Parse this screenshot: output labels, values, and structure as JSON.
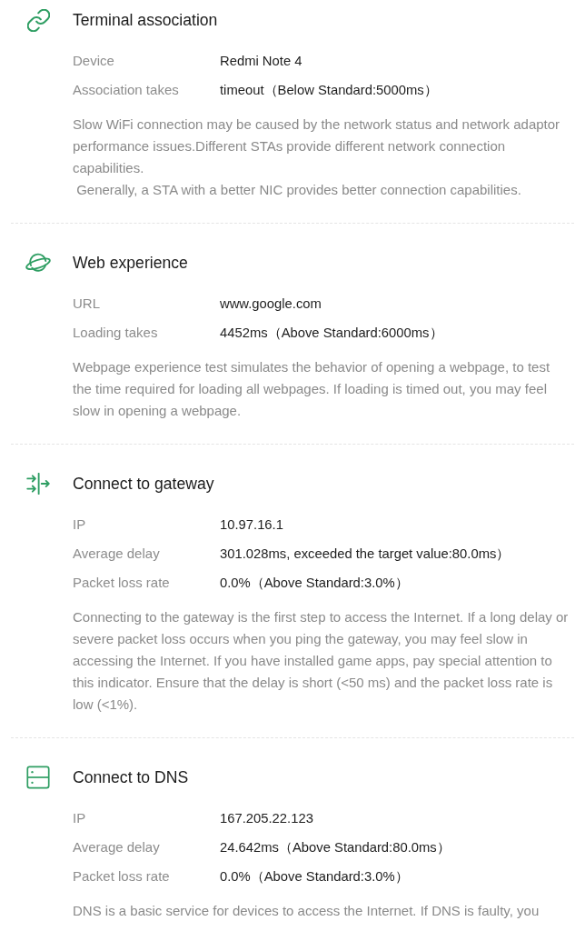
{
  "sections": [
    {
      "kind": "link",
      "title": "Terminal association",
      "rows": [
        {
          "label": "Device",
          "value": "Redmi Note 4"
        },
        {
          "label": "Association takes",
          "value": "timeout（Below Standard:5000ms）"
        }
      ],
      "description": "Slow WiFi connection may be caused by the network status and network adaptor performance issues.Different STAs provide different network connection capabilities.\n Generally, a STA with a better NIC provides better connection capabilities."
    },
    {
      "kind": "planet",
      "title": "Web experience",
      "rows": [
        {
          "label": "URL",
          "value": "www.google.com"
        },
        {
          "label": "Loading takes",
          "value": "4452ms（Above Standard:6000ms）"
        }
      ],
      "description": "Webpage experience test simulates the behavior of opening a webpage, to test the time required for loading all webpages. If loading is timed out, you may feel slow in opening a webpage."
    },
    {
      "kind": "gateway",
      "title": "Connect to gateway",
      "rows": [
        {
          "label": "IP",
          "value": "10.97.16.1"
        },
        {
          "label": "Average delay",
          "value": "301.028ms, exceeded the target value:80.0ms）"
        },
        {
          "label": "Packet loss rate",
          "value": "0.0%（Above Standard:3.0%）"
        }
      ],
      "description": "Connecting to the gateway is the first step to access the Internet. If a long delay or severe packet loss occurs when you ping the gateway, you may feel slow in accessing the Internet. If you have installed game apps, pay special attention to this indicator. Ensure that the delay is short (<50 ms) and the packet loss rate is low (<1%)."
    },
    {
      "kind": "server",
      "title": "Connect to DNS",
      "rows": [
        {
          "label": "IP",
          "value": "167.205.22.123"
        },
        {
          "label": "Average delay",
          "value": "24.642ms（Above Standard:80.0ms）"
        },
        {
          "label": "Packet loss rate",
          "value": "0.0%（Above Standard:3.0%）"
        }
      ],
      "description": "DNS is a basic service for devices to access the Internet. If DNS is faulty, you"
    }
  ]
}
